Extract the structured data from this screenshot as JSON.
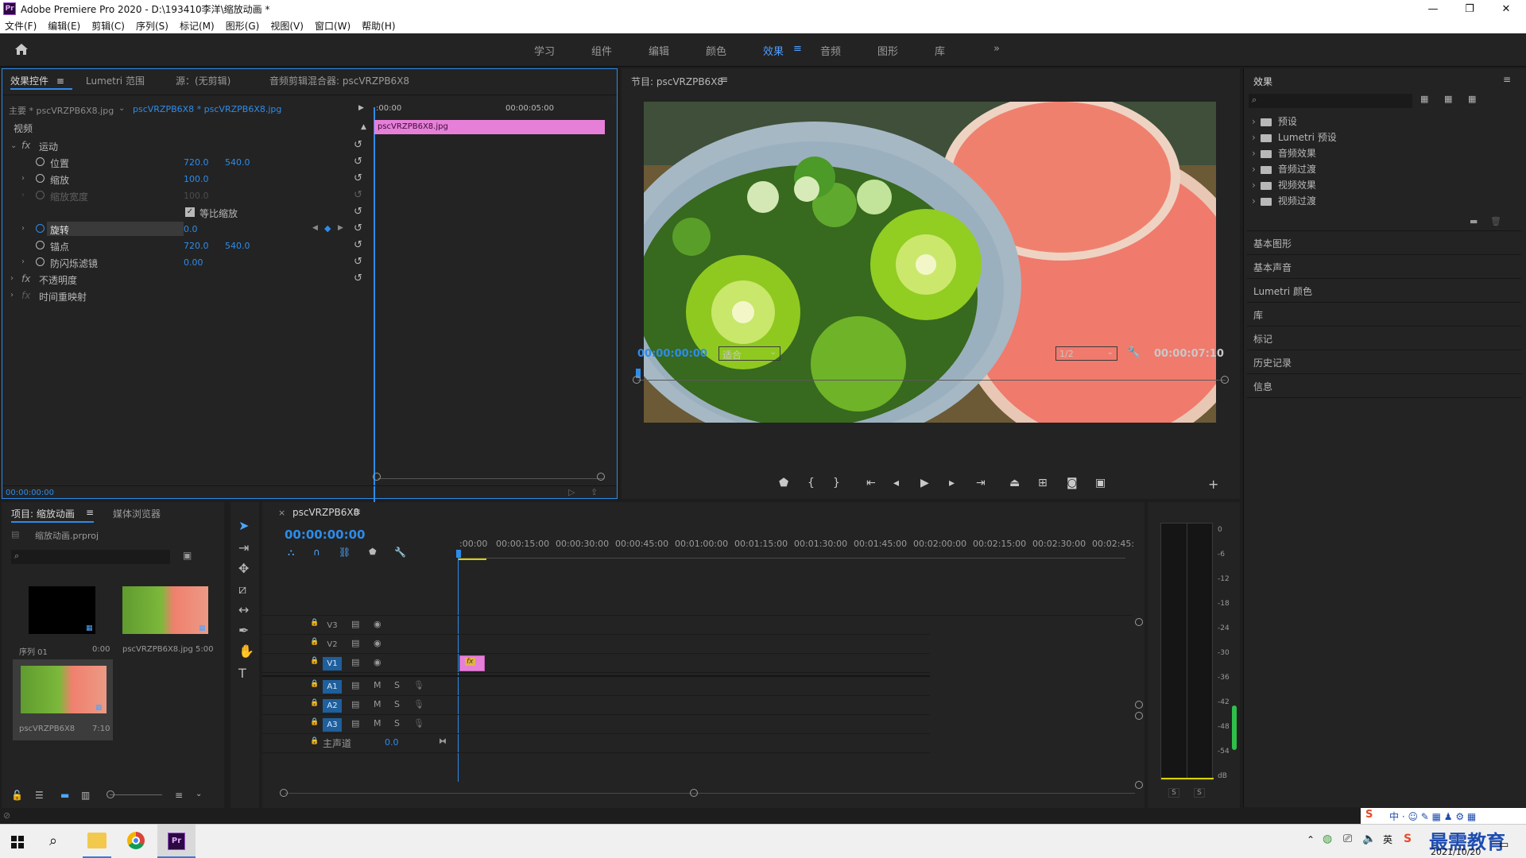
{
  "window": {
    "app_badge": "Pr",
    "title": "Adobe Premiere Pro 2020 - D:\\193410李洋\\缩放动画 *",
    "minimize": "—",
    "maximize": "❐",
    "close": "✕"
  },
  "menu": [
    "文件(F)",
    "编辑(E)",
    "剪辑(C)",
    "序列(S)",
    "标记(M)",
    "图形(G)",
    "视图(V)",
    "窗口(W)",
    "帮助(H)"
  ],
  "workspaces": {
    "items": [
      "学习",
      "组件",
      "编辑",
      "颜色",
      "效果",
      "音频",
      "图形",
      "库"
    ],
    "active": "效果",
    "more": "»"
  },
  "effect_controls": {
    "tabs": [
      "效果控件",
      "Lumetri 范围",
      "源：(无剪辑)",
      "音频剪辑混合器: pscVRZPB6X8"
    ],
    "master": "主要 * pscVRZPB6X8.jpg",
    "sequence_clip": "pscVRZPB6X8 * pscVRZPB6X8.jpg",
    "ruler_start": ":00:00",
    "ruler_mid": "00:00:05:00",
    "clip_bar": "pscVRZPB6X8.jpg",
    "section_video": "视频",
    "motion": "运动",
    "rows": [
      {
        "name": "位置",
        "v1": "720.0",
        "v2": "540.0"
      },
      {
        "name": "缩放",
        "v1": "100.0",
        "v2": ""
      },
      {
        "name": "缩放宽度",
        "v1": "100.0",
        "v2": ""
      },
      {
        "name": "等比缩放",
        "v1": "",
        "v2": ""
      },
      {
        "name": "旋转",
        "v1": "0.0",
        "v2": ""
      },
      {
        "name": "锚点",
        "v1": "720.0",
        "v2": "540.0"
      },
      {
        "name": "防闪烁滤镜",
        "v1": "0.00",
        "v2": ""
      }
    ],
    "opacity": "不透明度",
    "time_remap": "时间重映射",
    "timecode": "00:00:00:00"
  },
  "program_monitor": {
    "title": "节目: pscVRZPB6X8",
    "timecode_in": "00:00:00:00",
    "fit": "适合",
    "resolution": "1/2",
    "duration": "00:00:07:10"
  },
  "effects_panel": {
    "title": "效果",
    "search_placeholder": "",
    "tree": [
      "预设",
      "Lumetri 预设",
      "音频效果",
      "音频过渡",
      "视频效果",
      "视频过渡"
    ],
    "sections": [
      "基本图形",
      "基本声音",
      "Lumetri 颜色",
      "库",
      "标记",
      "历史记录",
      "信息"
    ]
  },
  "project": {
    "tabs": [
      "项目: 缩放动画",
      "媒体浏览器"
    ],
    "file": "缩放动画.prproj",
    "items": [
      {
        "name": "序列 01",
        "duration": "0:00"
      },
      {
        "name": "pscVRZPB6X8.jpg",
        "duration": "5:00"
      },
      {
        "name": "pscVRZPB6X8",
        "duration": "7:10"
      }
    ]
  },
  "timeline": {
    "tab": "pscVRZPB6X8",
    "timecode": "00:00:00:00",
    "ruler": [
      ":00:00",
      "00:00:15:00",
      "00:00:30:00",
      "00:00:45:00",
      "00:01:00:00",
      "00:01:15:00",
      "00:01:30:00",
      "00:01:45:00",
      "00:02:00:00",
      "00:02:15:00",
      "00:02:30:00",
      "00:02:45:"
    ],
    "video_tracks": [
      "V3",
      "V2",
      "V1"
    ],
    "audio_tracks": [
      "A1",
      "A2",
      "A3"
    ],
    "master": "主声道",
    "master_value": "0.0",
    "clip_label": "fx"
  },
  "meter": {
    "scale": [
      "0",
      "-6",
      "-12",
      "-18",
      "-24",
      "-30",
      "-36",
      "-42",
      "-48",
      "-54",
      "dB"
    ],
    "solo_left": "S",
    "solo_right": "S"
  },
  "taskbar": {
    "date": "2021/10/20",
    "watermark": "最需教育"
  },
  "colors": {
    "accent": "#2d8ceb",
    "clip_pink": "#e67fd8",
    "panel_bg": "#232323"
  }
}
